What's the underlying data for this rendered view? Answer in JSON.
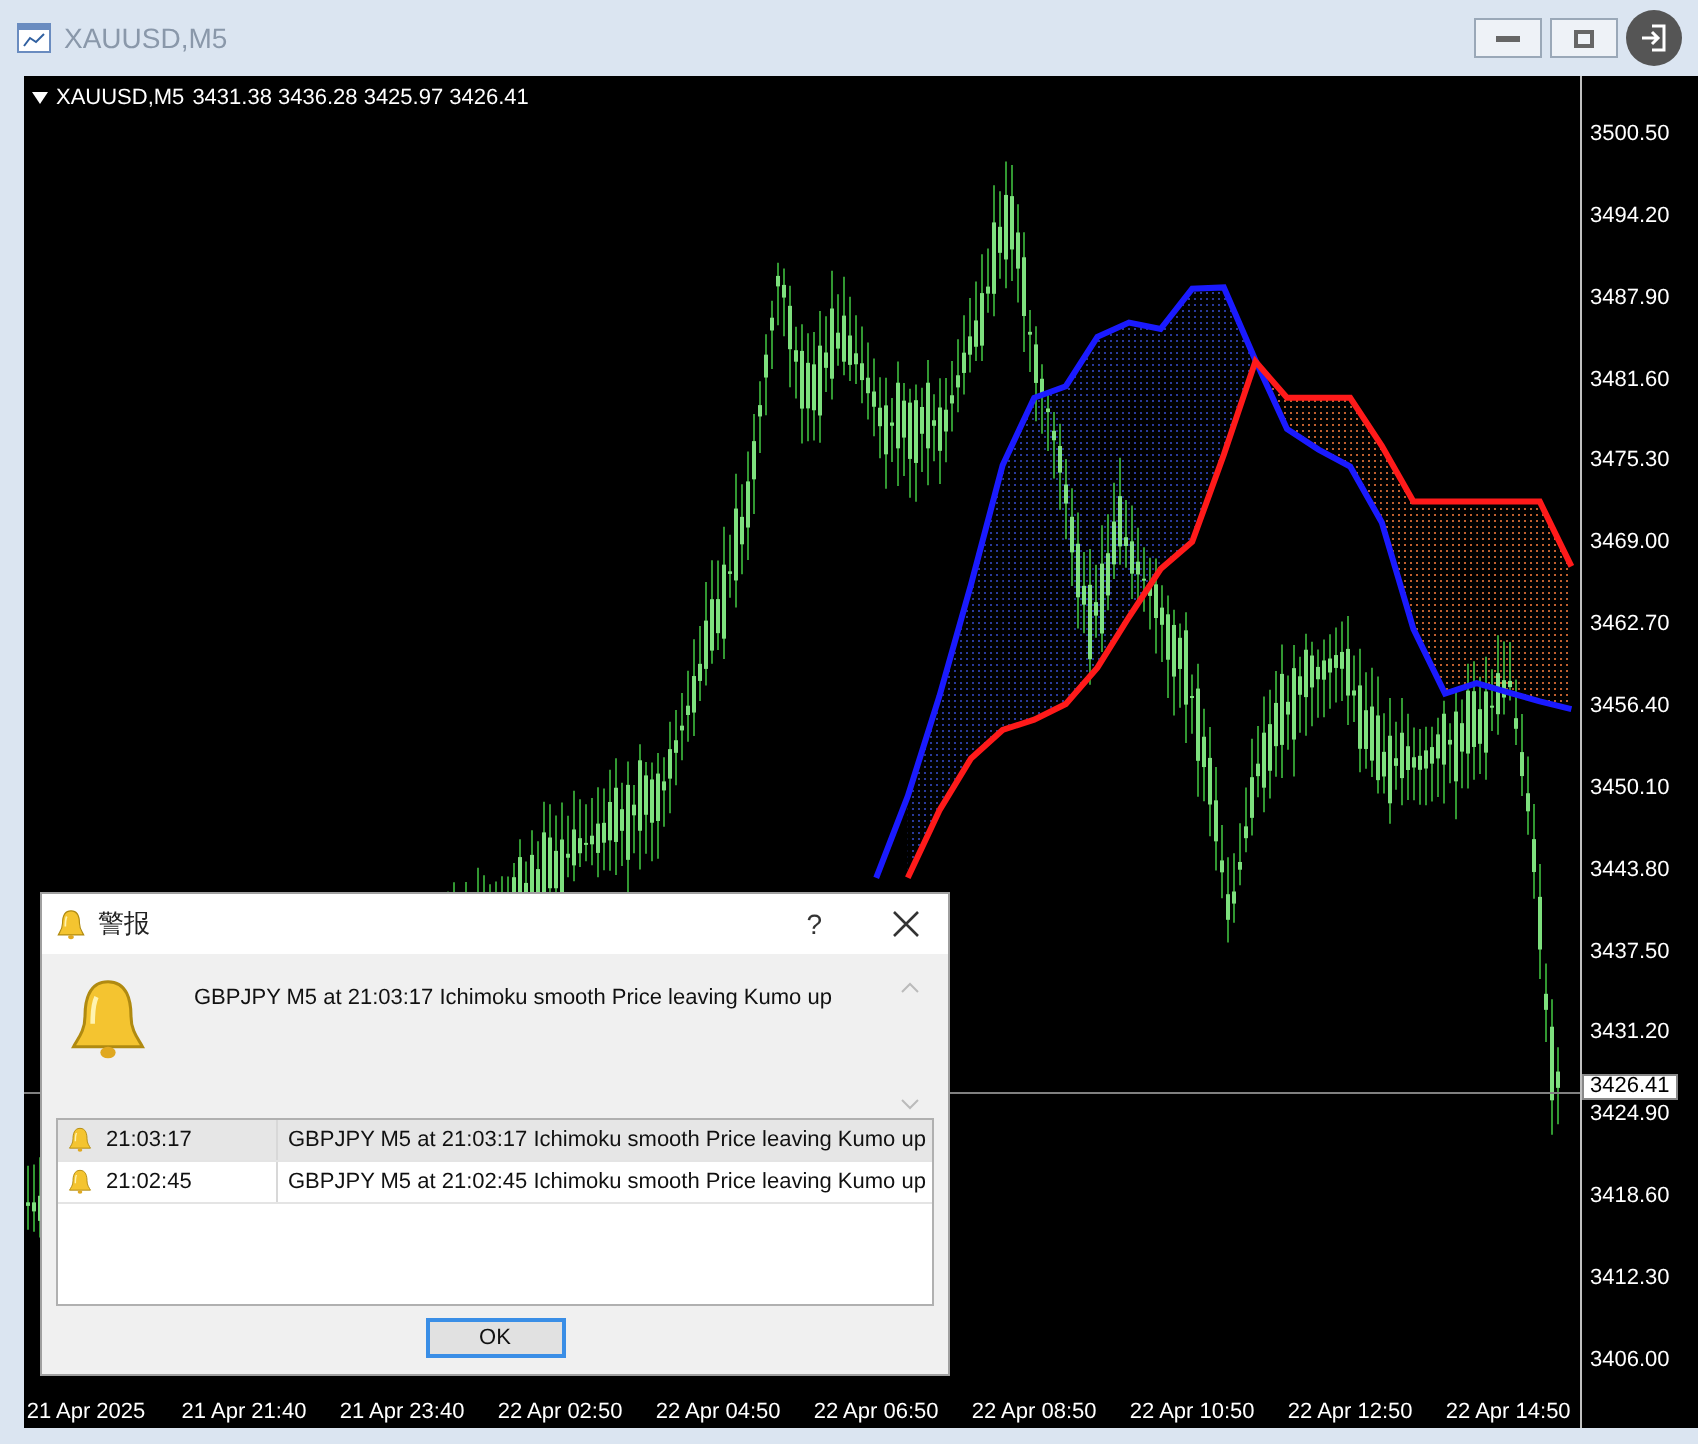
{
  "window": {
    "title": "XAUUSD,M5"
  },
  "chart": {
    "header": {
      "symbol": "XAUUSD,M5",
      "quote": "3431.38 3436.28 3425.97 3426.41"
    },
    "current_price": "3426.41",
    "chart_data": {
      "type": "line",
      "ylim": [
        3400.6,
        3504.8
      ],
      "categories": [
        "21 Apr 2025",
        null,
        null,
        null,
        null,
        "21 Apr 21:40",
        null,
        null,
        null,
        null,
        "21 Apr 23:40",
        null,
        null,
        null,
        null,
        "22 Apr 02:50",
        null,
        null,
        null,
        null,
        "22 Apr 04:50",
        null,
        null,
        null,
        null,
        "22 Apr 06:50",
        null,
        null,
        null,
        null,
        "22 Apr 08:50",
        null,
        null,
        null,
        null,
        "22 Apr 10:50",
        null,
        null,
        null,
        null,
        "22 Apr 12:50",
        null,
        null,
        null,
        null,
        "22 Apr 14:50",
        null,
        null,
        null,
        null,
        null,
        null,
        null
      ],
      "series": [
        {
          "color": "#1a1aff",
          "values": [
            null,
            null,
            null,
            null,
            null,
            null,
            null,
            null,
            null,
            null,
            null,
            null,
            null,
            null,
            null,
            null,
            null,
            null,
            null,
            null,
            null,
            null,
            null,
            null,
            null,
            3443,
            3449.3,
            3457,
            3465.6,
            3474.8,
            3480,
            3480.9,
            3484.7,
            3485.8,
            3485.3,
            3488.4,
            3488.5,
            3482.9,
            3477.6,
            3476,
            3474.7,
            3470.4,
            3462.2,
            3457.2,
            3458,
            3457.3,
            3456.6,
            3456,
            null,
            null,
            null,
            null,
            null
          ]
        },
        {
          "color": "#ff1a1a",
          "values": [
            null,
            null,
            null,
            null,
            null,
            null,
            null,
            null,
            null,
            null,
            null,
            null,
            null,
            null,
            null,
            null,
            null,
            null,
            null,
            null,
            null,
            null,
            null,
            null,
            null,
            null,
            3443,
            3448.2,
            3452.2,
            3454.4,
            3455.2,
            3456.4,
            3459.2,
            3463.1,
            3466.8,
            3468.9,
            3475.6,
            3482.8,
            3480,
            3480,
            3480,
            3476.3,
            3472,
            3472,
            3472,
            3472,
            3472,
            3467,
            null,
            null,
            null,
            null,
            null
          ]
        }
      ],
      "yticks": [
        {
          "value": 3500.5,
          "label": "3500.50"
        },
        {
          "value": 3494.2,
          "label": "3494.20"
        },
        {
          "value": 3487.9,
          "label": "3487.90"
        },
        {
          "value": 3481.6,
          "label": "3481.60"
        },
        {
          "value": 3475.3,
          "label": "3475.30"
        },
        {
          "value": 3469,
          "label": "3469.00"
        },
        {
          "value": 3462.7,
          "label": "3462.70"
        },
        {
          "value": 3456.4,
          "label": "3456.40"
        },
        {
          "value": 3450.1,
          "label": "3450.10"
        },
        {
          "value": 3443.8,
          "label": "3443.80"
        },
        {
          "value": 3437.5,
          "label": "3437.50"
        },
        {
          "value": 3431.2,
          "label": "3431.20"
        },
        {
          "value": 3424.9,
          "label": "3424.90"
        },
        {
          "value": 3418.6,
          "label": "3418.60"
        },
        {
          "value": 3412.3,
          "label": "3412.30"
        },
        {
          "value": 3406,
          "label": "3406.00"
        }
      ]
    }
  },
  "dialog": {
    "title": "警报",
    "help": "?",
    "message": "GBPJPY M5 at 21:03:17 Ichimoku smooth Price leaving Kumo up",
    "alerts": [
      {
        "time": "21:03:17",
        "text": "GBPJPY M5 at 21:03:17 Ichimoku smooth Price leaving Kumo up",
        "selected": true
      },
      {
        "time": "21:02:45",
        "text": "GBPJPY M5 at 21:02:45 Ichimoku smooth Price leaving Kumo up",
        "selected": false
      }
    ],
    "ok": "OK"
  }
}
